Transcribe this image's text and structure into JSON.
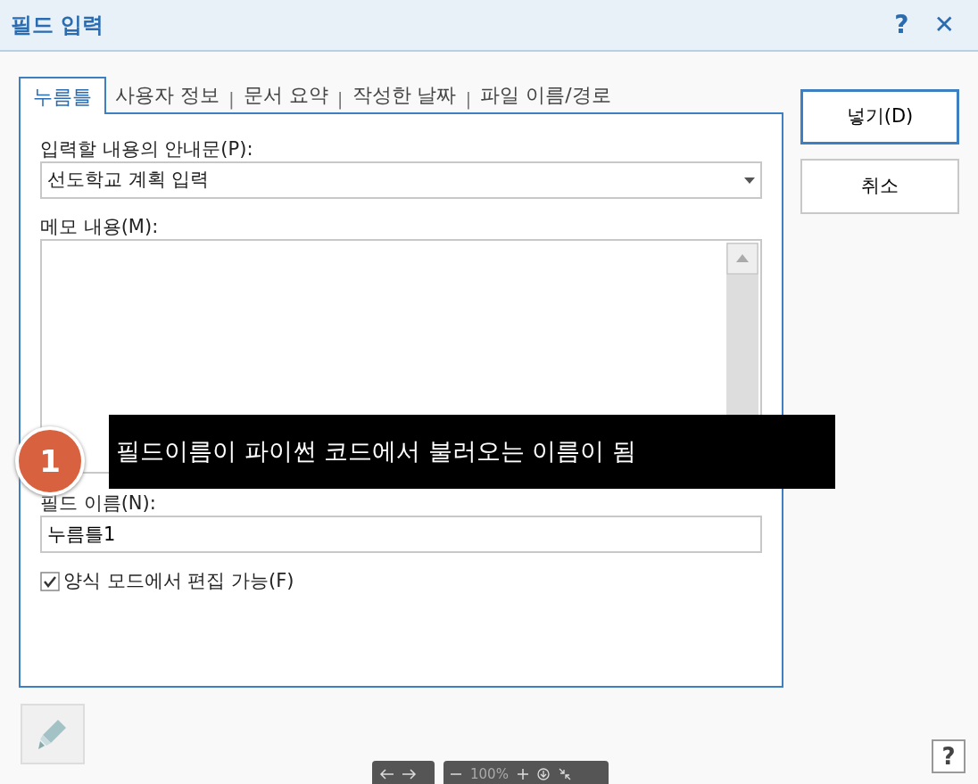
{
  "window": {
    "title": "필드 입력",
    "help": "?",
    "close": "✕"
  },
  "tabs": [
    {
      "label": "누름틀",
      "selected": true
    },
    {
      "label": "사용자 정보",
      "selected": false
    },
    {
      "label": "문서 요약",
      "selected": false
    },
    {
      "label": "작성한 날짜",
      "selected": false
    },
    {
      "label": "파일 이름/경로",
      "selected": false
    }
  ],
  "prompt": {
    "label": "입력할 내용의 안내문(P):",
    "value": "선도학교 계획 입력"
  },
  "memo": {
    "label": "메모 내용(M):"
  },
  "field_name": {
    "label": "필드 이름(N):",
    "value": "누름틀1"
  },
  "editable": {
    "label": "양식 모드에서 편집 가능(F)",
    "checked": true
  },
  "buttons": [
    {
      "label": "넣기(D)",
      "default": true
    },
    {
      "label": "취소",
      "default": false
    }
  ],
  "help_button": "?",
  "callout": {
    "number": "1",
    "text": "필드이름이 파이썬 코드에서 불러오는 이름이 됨"
  },
  "tab_separator": "|",
  "viewer_toolbar": {
    "zoom": "100%"
  }
}
